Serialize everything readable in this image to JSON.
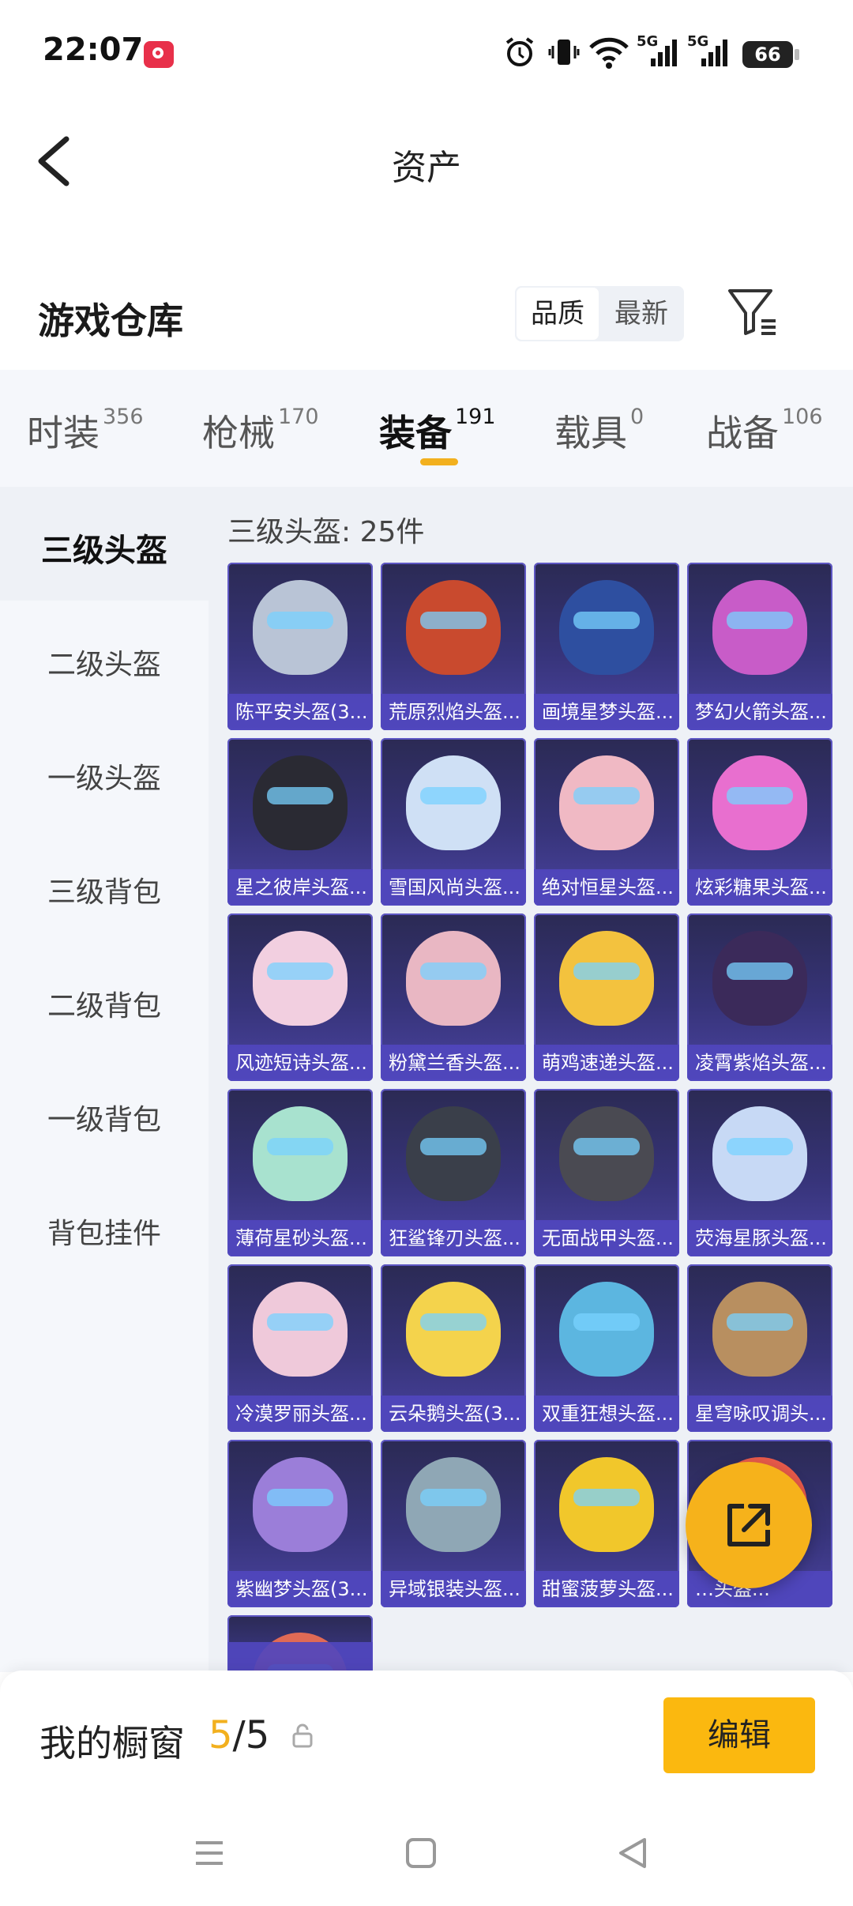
{
  "status": {
    "time": "22:07",
    "battery": "66",
    "network": [
      "5G",
      "5G"
    ]
  },
  "header": {
    "title": "资产"
  },
  "warehouse": {
    "title": "游戏仓库",
    "sort": [
      "品质",
      "最新"
    ]
  },
  "tabs": [
    {
      "label": "时装",
      "count": "356"
    },
    {
      "label": "枪械",
      "count": "170"
    },
    {
      "label": "装备",
      "count": "191"
    },
    {
      "label": "载具",
      "count": "0"
    },
    {
      "label": "战备",
      "count": "106"
    }
  ],
  "active_tab": "装备",
  "sidebar": [
    "三级头盔",
    "二级头盔",
    "一级头盔",
    "三级背包",
    "二级背包",
    "一级背包",
    "背包挂件"
  ],
  "subheader": "三级头盔: 25件",
  "items": [
    {
      "name": "陈平安头盔(3...",
      "color": "#b9c4d6"
    },
    {
      "name": "荒原烈焰头盔...",
      "color": "#c94a2e"
    },
    {
      "name": "画境星梦头盔...",
      "color": "#2e4fa0"
    },
    {
      "name": "梦幻火箭头盔...",
      "color": "#c85cc8"
    },
    {
      "name": "星之彼岸头盔...",
      "color": "#2a2a33"
    },
    {
      "name": "雪国风尚头盔...",
      "color": "#cfe0f5"
    },
    {
      "name": "绝对恒星头盔...",
      "color": "#f0b9c4"
    },
    {
      "name": "炫彩糖果头盔...",
      "color": "#e86fcf"
    },
    {
      "name": "风迹短诗头盔...",
      "color": "#f2cfe0"
    },
    {
      "name": "粉黛兰香头盔...",
      "color": "#e9b7c3"
    },
    {
      "name": "萌鸡速递头盔...",
      "color": "#f3c23e"
    },
    {
      "name": "凌霄紫焰头盔...",
      "color": "#3b2a5a"
    },
    {
      "name": "薄荷星砂头盔...",
      "color": "#a8e2cf"
    },
    {
      "name": "狂鲨锋刃头盔...",
      "color": "#3a3f4a"
    },
    {
      "name": "无面战甲头盔...",
      "color": "#4a4a52"
    },
    {
      "name": "荧海星豚头盔...",
      "color": "#c7d9f5"
    },
    {
      "name": "冷漠罗丽头盔...",
      "color": "#efc9da"
    },
    {
      "name": "云朵鹅头盔(3...",
      "color": "#f4d34c"
    },
    {
      "name": "双重狂想头盔...",
      "color": "#5cb6e0"
    },
    {
      "name": "星穹咏叹调头...",
      "color": "#b88f60"
    },
    {
      "name": "紫幽梦头盔(3...",
      "color": "#9b7ed9"
    },
    {
      "name": "异域银装头盔...",
      "color": "#8fa7b5"
    },
    {
      "name": "甜蜜菠萝头盔...",
      "color": "#f1c72b"
    },
    {
      "name": "…头盔...",
      "color": "#e85a4a"
    },
    {
      "name": "",
      "color": "#e06a55"
    }
  ],
  "bottom": {
    "label": "我的橱窗",
    "current": "5",
    "total": "/5",
    "edit": "编辑"
  },
  "colors": {
    "accent": "#f2b01e",
    "card_bg": "#37347a",
    "card_label": "#5046be"
  }
}
